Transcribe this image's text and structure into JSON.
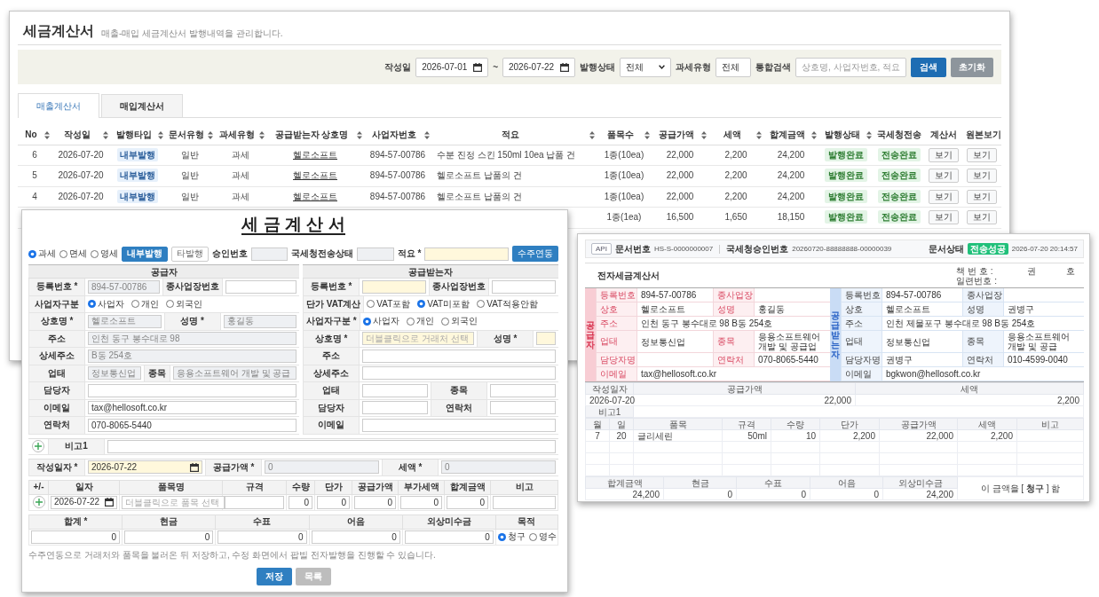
{
  "list_window": {
    "title": "세금계산서",
    "subtitle": "매출-매입 세금계산서 발행내역을 관리합니다.",
    "filters": [
      {
        "kind": "label",
        "text": "작성일"
      },
      {
        "kind": "date",
        "value": "2026-07-01"
      },
      {
        "kind": "label",
        "text": "~"
      },
      {
        "kind": "date",
        "value": "2026-07-22"
      },
      {
        "kind": "label",
        "text": "발행상태"
      },
      {
        "kind": "select",
        "value": "전체"
      },
      {
        "kind": "label",
        "text": "과세유형"
      },
      {
        "kind": "select",
        "value": "전체"
      },
      {
        "kind": "label",
        "text": "통합검색"
      },
      {
        "kind": "search",
        "placeholder": "상호명, 사업자번호, 적요"
      },
      {
        "kind": "search_button",
        "text": "검색"
      },
      {
        "kind": "reset_button",
        "text": "초기화"
      }
    ],
    "tabs": [
      {
        "label": "매출계산서",
        "selected": true
      },
      {
        "label": "매입계산서",
        "selected": false
      }
    ],
    "table": {
      "columns": [
        {
          "label": "No",
          "sortable": true,
          "kind": "text"
        },
        {
          "label": "작성일",
          "sortable": true,
          "kind": "text"
        },
        {
          "label": "발행타입",
          "sortable": true,
          "kind": "type_badge"
        },
        {
          "label": "문서유형",
          "sortable": true,
          "kind": "text"
        },
        {
          "label": "과세유형",
          "sortable": true,
          "kind": "text"
        },
        {
          "label": "공급받는자 상호명",
          "sortable": true,
          "kind": "link"
        },
        {
          "label": "사업자번호",
          "sortable": true,
          "kind": "text"
        },
        {
          "label": "적요",
          "sortable": true,
          "kind": "memo"
        },
        {
          "label": "품목수",
          "sortable": true,
          "kind": "text"
        },
        {
          "label": "공급가액",
          "sortable": true,
          "kind": "text"
        },
        {
          "label": "세액",
          "sortable": true,
          "kind": "text"
        },
        {
          "label": "합계금액",
          "sortable": true,
          "kind": "text"
        },
        {
          "label": "발행상태",
          "sortable": true,
          "kind": "status_badge"
        },
        {
          "label": "국세청전송",
          "sortable": false,
          "kind": "status_badge"
        },
        {
          "label": "계산서",
          "sortable": false,
          "kind": "button"
        },
        {
          "label": "원본보기",
          "sortable": false,
          "kind": "button"
        }
      ],
      "rows": [
        [
          "6",
          "2026-07-20",
          "내부발행",
          "일반",
          "과세",
          "헬로소프트",
          "894-57-00786",
          "수분 진정 스킨 150ml 10ea 납품 건",
          "1종(10ea)",
          "22,000",
          "2,200",
          "24,200",
          "발행완료",
          "전송완료",
          "보기",
          "보기"
        ],
        [
          "5",
          "2026-07-20",
          "내부발행",
          "일반",
          "과세",
          "헬로소프트",
          "894-57-00786",
          "헬로소프트 납품의 건",
          "1종(10ea)",
          "22,000",
          "2,200",
          "24,200",
          "발행완료",
          "전송완료",
          "보기",
          "보기"
        ],
        [
          "4",
          "2026-07-20",
          "내부발행",
          "일반",
          "과세",
          "헬로소프트",
          "894-57-00786",
          "헬로소프트 납품의 건",
          "1종(10ea)",
          "22,000",
          "2,200",
          "24,200",
          "발행완료",
          "전송완료",
          "보기",
          "보기"
        ],
        [
          null,
          null,
          null,
          null,
          null,
          null,
          null,
          null,
          "1종(1ea)",
          "16,500",
          "1,650",
          "18,150",
          "발행완료",
          "전송완료",
          "보기",
          "보기"
        ]
      ]
    }
  },
  "form_window": {
    "title": "세 금 계 산 서",
    "top_bar": [
      {
        "kind": "radio",
        "label": "과세",
        "selected": true
      },
      {
        "kind": "radio",
        "label": "면세",
        "selected": false
      },
      {
        "kind": "radio",
        "label": "영세",
        "selected": false
      },
      {
        "kind": "toggle",
        "label": "내부발행",
        "selected": true
      },
      {
        "kind": "toggle",
        "label": "타발행",
        "selected": false
      },
      {
        "kind": "label",
        "text": "승인번호"
      },
      {
        "kind": "input",
        "readonly": true
      },
      {
        "kind": "label",
        "text": "국세청전송상태"
      },
      {
        "kind": "input",
        "readonly": true
      },
      {
        "kind": "label",
        "text": "적요 *"
      },
      {
        "kind": "input",
        "required": true
      },
      {
        "kind": "button",
        "label": "수주연동"
      }
    ],
    "parties": [
      {
        "heading": "공급자",
        "rows": [
          [
            {
              "kind": "label",
              "text": "등록번호 *"
            },
            {
              "kind": "input",
              "value": "894-57-00786",
              "readonly": true
            },
            {
              "kind": "label",
              "text": "종사업장번호"
            },
            {
              "kind": "input"
            }
          ],
          [
            {
              "kind": "label",
              "text": "사업자구분"
            },
            {
              "kind": "radios",
              "options": [
                {
                  "label": "사업자",
                  "selected": true
                },
                {
                  "label": "개인",
                  "selected": false
                },
                {
                  "label": "외국인",
                  "selected": false
                }
              ]
            }
          ],
          [
            {
              "kind": "label",
              "text": "상호명 *"
            },
            {
              "kind": "input",
              "value": "헬로소프트",
              "readonly": true
            },
            {
              "kind": "label",
              "text": "성명 *"
            },
            {
              "kind": "input",
              "value": "홍길동",
              "readonly": true
            }
          ],
          [
            {
              "kind": "label",
              "text": "주소"
            },
            {
              "kind": "input",
              "value": "인천 동구 봉수대로 98",
              "readonly": true
            }
          ],
          [
            {
              "kind": "label",
              "text": "상세주소"
            },
            {
              "kind": "input",
              "value": "B동 254호",
              "readonly": true
            }
          ],
          [
            {
              "kind": "label",
              "text": "업태"
            },
            {
              "kind": "input",
              "value": "정보통신업",
              "readonly": true
            },
            {
              "kind": "label",
              "text": "종목"
            },
            {
              "kind": "input",
              "value": "응용소프트웨어 개발 및 공급",
              "readonly": true
            }
          ],
          [
            {
              "kind": "label",
              "text": "담당자"
            },
            {
              "kind": "input"
            }
          ],
          [
            {
              "kind": "label",
              "text": "이메일"
            },
            {
              "kind": "input",
              "value": "tax@hellosoft.co.kr"
            }
          ],
          [
            {
              "kind": "label",
              "text": "연락처"
            },
            {
              "kind": "input",
              "value": "070-8065-5440"
            }
          ]
        ]
      },
      {
        "heading": "공급받는자",
        "rows": [
          [
            {
              "kind": "label",
              "text": "등록번호 *"
            },
            {
              "kind": "input",
              "required": true
            },
            {
              "kind": "label",
              "text": "종사업장번호"
            },
            {
              "kind": "input"
            }
          ],
          [
            {
              "kind": "label",
              "text": "단가 VAT계산"
            },
            {
              "kind": "radios",
              "options": [
                {
                  "label": "VAT포함",
                  "selected": false
                },
                {
                  "label": "VAT미포함",
                  "selected": true
                },
                {
                  "label": "VAT적용안함",
                  "selected": false
                }
              ]
            }
          ],
          [
            {
              "kind": "label",
              "text": "사업자구분 *"
            },
            {
              "kind": "radios",
              "options": [
                {
                  "label": "사업자",
                  "selected": true
                },
                {
                  "label": "개인",
                  "selected": false
                },
                {
                  "label": "외국인",
                  "selected": false
                }
              ]
            }
          ],
          [
            {
              "kind": "label",
              "text": "상호명 *"
            },
            {
              "kind": "input",
              "placeholder": "더블클릭으로 거래처 선택",
              "required": true
            },
            {
              "kind": "label",
              "text": "성명 *"
            },
            {
              "kind": "input",
              "required": true
            }
          ],
          [
            {
              "kind": "label",
              "text": "주소"
            },
            {
              "kind": "input"
            }
          ],
          [
            {
              "kind": "label",
              "text": "상세주소"
            },
            {
              "kind": "input"
            }
          ],
          [
            {
              "kind": "label",
              "text": "업태"
            },
            {
              "kind": "input"
            },
            {
              "kind": "label",
              "text": "종목"
            },
            {
              "kind": "input"
            }
          ],
          [
            {
              "kind": "label",
              "text": "담당자"
            },
            {
              "kind": "input"
            },
            {
              "kind": "label",
              "text": "연락처"
            },
            {
              "kind": "input"
            }
          ],
          [
            {
              "kind": "label",
              "text": "이메일"
            },
            {
              "kind": "input"
            }
          ]
        ]
      }
    ],
    "remarks": [
      {
        "label": "비고1"
      }
    ],
    "date_row": [
      {
        "kind": "label",
        "text": "작성일자 *"
      },
      {
        "kind": "date",
        "value": "2026-07-22",
        "required": true
      },
      {
        "kind": "label",
        "text": "공급가액 *"
      },
      {
        "kind": "input",
        "value": "0",
        "readonly": true
      },
      {
        "kind": "label",
        "text": "세액 *"
      },
      {
        "kind": "input",
        "value": "0",
        "readonly": true
      }
    ],
    "items": {
      "columns": [
        "+/-",
        "일자",
        "품목명",
        "규격",
        "수량",
        "단가",
        "공급가액",
        "부가세액",
        "합계금액",
        "비고"
      ],
      "rows": [
        [
          {
            "kind": "add"
          },
          {
            "kind": "date",
            "value": "2026-07-22"
          },
          {
            "kind": "input",
            "placeholder": "더블클릭으로 품목 선택"
          },
          {
            "kind": "input"
          },
          {
            "kind": "number",
            "value": "0"
          },
          {
            "kind": "number",
            "value": "0"
          },
          {
            "kind": "number",
            "value": "0"
          },
          {
            "kind": "number",
            "value": "0"
          },
          {
            "kind": "number",
            "value": "0"
          },
          {
            "kind": "input"
          }
        ]
      ]
    },
    "totals": {
      "columns": [
        "합계 *",
        "현금",
        "수표",
        "어음",
        "외상미수금",
        "목적"
      ],
      "values": [
        "0",
        "0",
        "0",
        "0",
        "0"
      ],
      "purpose": [
        {
          "label": "청구",
          "selected": true
        },
        {
          "label": "영수",
          "selected": false
        }
      ]
    },
    "note": "수주연동으로 거래처와 품목을 불러온 뒤 저장하고, 수정 화면에서 팝빌 전자발행을 진행할 수 있습니다.",
    "buttons": [
      {
        "kind": "primary",
        "label": "저장"
      },
      {
        "kind": "secondary",
        "label": "목록"
      }
    ]
  },
  "document_window": {
    "header": {
      "api_badge": "API",
      "doc_no_label": "문서번호",
      "doc_no": "HS-S-0000000007",
      "approval_label": "국세청승인번호",
      "approval_no": "20260720-88888888-00000039",
      "status_label": "문서상태",
      "status": "전송성공",
      "timestamp": "2026-07-20 20:14:57"
    },
    "title": "전자세금계산서",
    "book_no": {
      "label": "책 번 호 :",
      "volume": "권",
      "number": "호"
    },
    "serial_no": {
      "label": "일련번호 :"
    },
    "parties": [
      {
        "kind": "supplier",
        "side_label": "공급자",
        "rows": [
          [
            {
              "label": "등록번호",
              "value": "894-57-00786"
            },
            {
              "label": "종사업장"
            }
          ],
          [
            {
              "label": "상호",
              "value": "헬로소프트"
            },
            {
              "label": "성명",
              "value": "홍길동"
            }
          ],
          [
            {
              "label": "주소",
              "value": "인천 동구 봉수대로 98 B동 254호"
            }
          ],
          [
            {
              "label": "업태",
              "value": "정보통신업"
            },
            {
              "label": "종목",
              "value": "응용소프트웨어 개발 및 공급업"
            }
          ],
          [
            {
              "label": "담당자명"
            },
            {
              "label": "연락처",
              "value": "070-8065-5440"
            }
          ],
          [
            {
              "label": "이메일",
              "value": "tax@hellosoft.co.kr"
            }
          ]
        ]
      },
      {
        "kind": "buyer",
        "side_label": "공급받는자",
        "rows": [
          [
            {
              "label": "등록번호",
              "value": "894-57-00786"
            },
            {
              "label": "종사업장"
            }
          ],
          [
            {
              "label": "상호",
              "value": "헬로소프트"
            },
            {
              "label": "성명",
              "value": "권병구"
            }
          ],
          [
            {
              "label": "주소",
              "value": "인천 제물포구 봉수대로 98 B동 254호"
            }
          ],
          [
            {
              "label": "업태",
              "value": "정보통신업"
            },
            {
              "label": "종목",
              "value": "응용소프트웨어 개발 및 공급"
            }
          ],
          [
            {
              "label": "담당자명",
              "value": "권병구"
            },
            {
              "label": "연락처",
              "value": "010-4599-0040"
            }
          ],
          [
            {
              "label": "이메일",
              "value": "bgkwon@hellosoft.co.kr"
            }
          ]
        ]
      }
    ],
    "amounts": {
      "columns": [
        "작성일자",
        "공급가액",
        "세액"
      ],
      "values": [
        "2026-07-20",
        "22,000",
        "2,200"
      ],
      "remark_label": "비고1"
    },
    "items": {
      "columns": [
        "월",
        "일",
        "품목",
        "규격",
        "수량",
        "단가",
        "공급가액",
        "세액",
        "비고"
      ],
      "rows": [
        [
          "7",
          "20",
          "글리세린",
          "50ml",
          "10",
          "2,200",
          "22,000",
          "2,200"
        ]
      ]
    },
    "totals": {
      "columns": [
        "합계금액",
        "현금",
        "수표",
        "어음",
        "외상미수금"
      ],
      "values": [
        "24,200",
        "0",
        "0",
        "0",
        "24,200"
      ],
      "statement": "이 금액을 [ **청구** ] 함"
    }
  }
}
